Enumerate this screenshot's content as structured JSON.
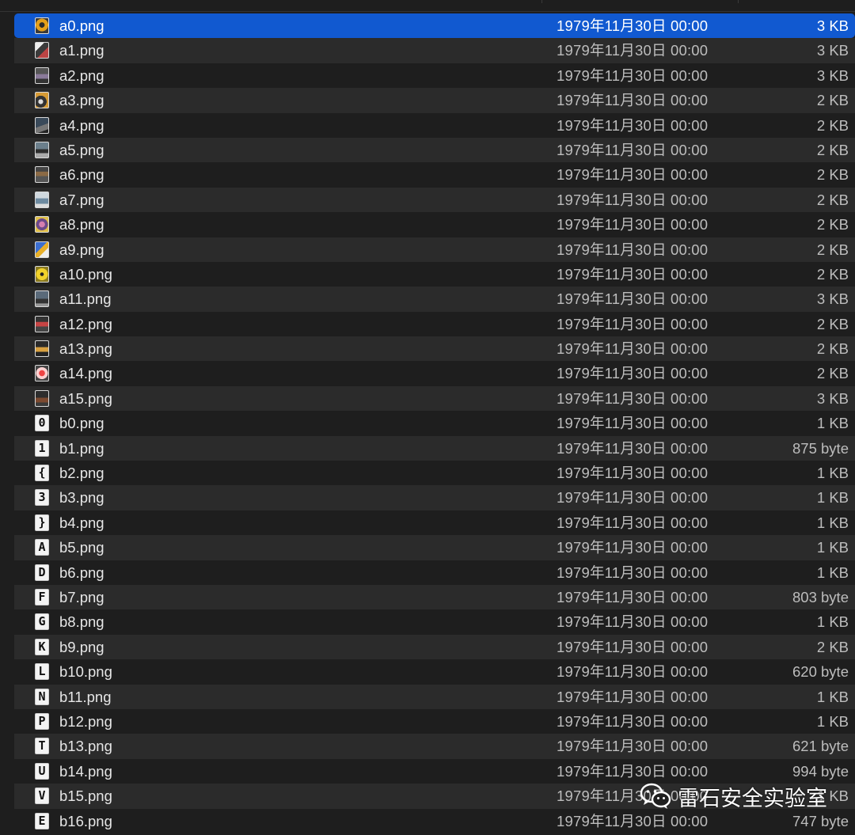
{
  "files": [
    {
      "name": "a0.png",
      "date": "1979年11月30日 00:00",
      "size": "3 KB",
      "icon": "image-thumbnail-icon",
      "glyph": "",
      "selected": true
    },
    {
      "name": "a1.png",
      "date": "1979年11月30日 00:00",
      "size": "3 KB",
      "icon": "image-thumbnail-icon",
      "glyph": ""
    },
    {
      "name": "a2.png",
      "date": "1979年11月30日 00:00",
      "size": "3 KB",
      "icon": "image-thumbnail-icon",
      "glyph": ""
    },
    {
      "name": "a3.png",
      "date": "1979年11月30日 00:00",
      "size": "2 KB",
      "icon": "image-thumbnail-icon",
      "glyph": ""
    },
    {
      "name": "a4.png",
      "date": "1979年11月30日 00:00",
      "size": "2 KB",
      "icon": "image-thumbnail-icon",
      "glyph": ""
    },
    {
      "name": "a5.png",
      "date": "1979年11月30日 00:00",
      "size": "2 KB",
      "icon": "image-thumbnail-icon",
      "glyph": ""
    },
    {
      "name": "a6.png",
      "date": "1979年11月30日 00:00",
      "size": "2 KB",
      "icon": "image-thumbnail-icon",
      "glyph": ""
    },
    {
      "name": "a7.png",
      "date": "1979年11月30日 00:00",
      "size": "2 KB",
      "icon": "image-thumbnail-icon",
      "glyph": ""
    },
    {
      "name": "a8.png",
      "date": "1979年11月30日 00:00",
      "size": "2 KB",
      "icon": "image-thumbnail-icon",
      "glyph": ""
    },
    {
      "name": "a9.png",
      "date": "1979年11月30日 00:00",
      "size": "2 KB",
      "icon": "image-thumbnail-icon",
      "glyph": ""
    },
    {
      "name": "a10.png",
      "date": "1979年11月30日 00:00",
      "size": "2 KB",
      "icon": "image-thumbnail-icon",
      "glyph": ""
    },
    {
      "name": "a11.png",
      "date": "1979年11月30日 00:00",
      "size": "3 KB",
      "icon": "image-thumbnail-icon",
      "glyph": ""
    },
    {
      "name": "a12.png",
      "date": "1979年11月30日 00:00",
      "size": "2 KB",
      "icon": "image-thumbnail-icon",
      "glyph": ""
    },
    {
      "name": "a13.png",
      "date": "1979年11月30日 00:00",
      "size": "2 KB",
      "icon": "image-thumbnail-icon",
      "glyph": ""
    },
    {
      "name": "a14.png",
      "date": "1979年11月30日 00:00",
      "size": "2 KB",
      "icon": "image-thumbnail-icon",
      "glyph": ""
    },
    {
      "name": "a15.png",
      "date": "1979年11月30日 00:00",
      "size": "3 KB",
      "icon": "image-thumbnail-icon",
      "glyph": ""
    },
    {
      "name": "b0.png",
      "date": "1979年11月30日 00:00",
      "size": "1 KB",
      "icon": "glyph-thumbnail-icon",
      "glyph": "0"
    },
    {
      "name": "b1.png",
      "date": "1979年11月30日 00:00",
      "size": "875 byte",
      "icon": "glyph-thumbnail-icon",
      "glyph": "1"
    },
    {
      "name": "b2.png",
      "date": "1979年11月30日 00:00",
      "size": "1 KB",
      "icon": "glyph-thumbnail-icon",
      "glyph": "{"
    },
    {
      "name": "b3.png",
      "date": "1979年11月30日 00:00",
      "size": "1 KB",
      "icon": "glyph-thumbnail-icon",
      "glyph": "3"
    },
    {
      "name": "b4.png",
      "date": "1979年11月30日 00:00",
      "size": "1 KB",
      "icon": "glyph-thumbnail-icon",
      "glyph": "}"
    },
    {
      "name": "b5.png",
      "date": "1979年11月30日 00:00",
      "size": "1 KB",
      "icon": "glyph-thumbnail-icon",
      "glyph": "A"
    },
    {
      "name": "b6.png",
      "date": "1979年11月30日 00:00",
      "size": "1 KB",
      "icon": "glyph-thumbnail-icon",
      "glyph": "D"
    },
    {
      "name": "b7.png",
      "date": "1979年11月30日 00:00",
      "size": "803 byte",
      "icon": "glyph-thumbnail-icon",
      "glyph": "F"
    },
    {
      "name": "b8.png",
      "date": "1979年11月30日 00:00",
      "size": "1 KB",
      "icon": "glyph-thumbnail-icon",
      "glyph": "G"
    },
    {
      "name": "b9.png",
      "date": "1979年11月30日 00:00",
      "size": "2 KB",
      "icon": "glyph-thumbnail-icon",
      "glyph": "K"
    },
    {
      "name": "b10.png",
      "date": "1979年11月30日 00:00",
      "size": "620 byte",
      "icon": "glyph-thumbnail-icon",
      "glyph": "L"
    },
    {
      "name": "b11.png",
      "date": "1979年11月30日 00:00",
      "size": "1 KB",
      "icon": "glyph-thumbnail-icon",
      "glyph": "N"
    },
    {
      "name": "b12.png",
      "date": "1979年11月30日 00:00",
      "size": "1 KB",
      "icon": "glyph-thumbnail-icon",
      "glyph": "P"
    },
    {
      "name": "b13.png",
      "date": "1979年11月30日 00:00",
      "size": "621 byte",
      "icon": "glyph-thumbnail-icon",
      "glyph": "T"
    },
    {
      "name": "b14.png",
      "date": "1979年11月30日 00:00",
      "size": "994 byte",
      "icon": "glyph-thumbnail-icon",
      "glyph": "U"
    },
    {
      "name": "b15.png",
      "date": "1979年11月30日 00:00",
      "size": "1 KB",
      "icon": "glyph-thumbnail-icon",
      "glyph": "V"
    },
    {
      "name": "b16.png",
      "date": "1979年11月30日 00:00",
      "size": "747 byte",
      "icon": "glyph-thumbnail-icon",
      "glyph": "E"
    }
  ],
  "watermark": {
    "text": "雷石安全实验室",
    "icon": "wechat-logo-icon"
  },
  "colors": {
    "selection": "#1159d0",
    "row_alt": "#2b2b2b",
    "background": "#1e1e1e",
    "text": "#e6e6e6",
    "secondary_text": "#bdbdbd"
  }
}
